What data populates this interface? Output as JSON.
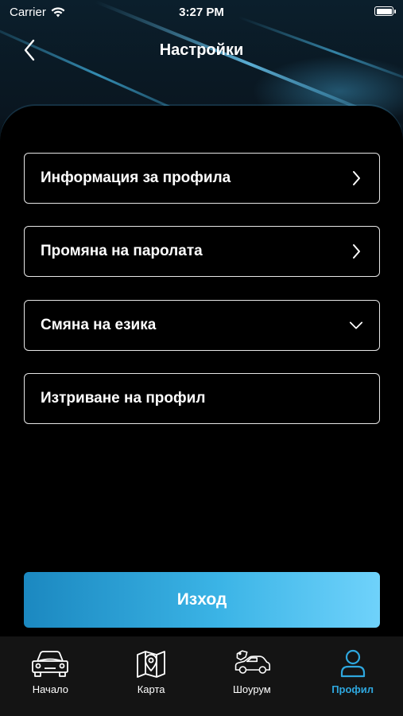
{
  "status_bar": {
    "carrier": "Carrier",
    "time": "3:27 PM"
  },
  "header": {
    "title": "Настройки"
  },
  "menu": [
    {
      "label": "Информация за профила",
      "icon": "chevron-right-icon"
    },
    {
      "label": "Промяна на паролата",
      "icon": "chevron-right-icon"
    },
    {
      "label": "Смяна на езика",
      "icon": "chevron-down-icon"
    },
    {
      "label": "Изтриване на профил",
      "icon": ""
    }
  ],
  "logout": {
    "label": "Изход"
  },
  "tabs": [
    {
      "label": "Начало",
      "icon": "car-front-icon",
      "active": false
    },
    {
      "label": "Карта",
      "icon": "map-pin-icon",
      "active": false
    },
    {
      "label": "Шоурум",
      "icon": "car-tag-icon",
      "active": false
    },
    {
      "label": "Профил",
      "icon": "user-icon",
      "active": true
    }
  ],
  "colors": {
    "accent": "#2ea7de",
    "button_start": "#1b88c0",
    "button_end": "#6fd2fb",
    "tabbar_bg": "#141414"
  }
}
